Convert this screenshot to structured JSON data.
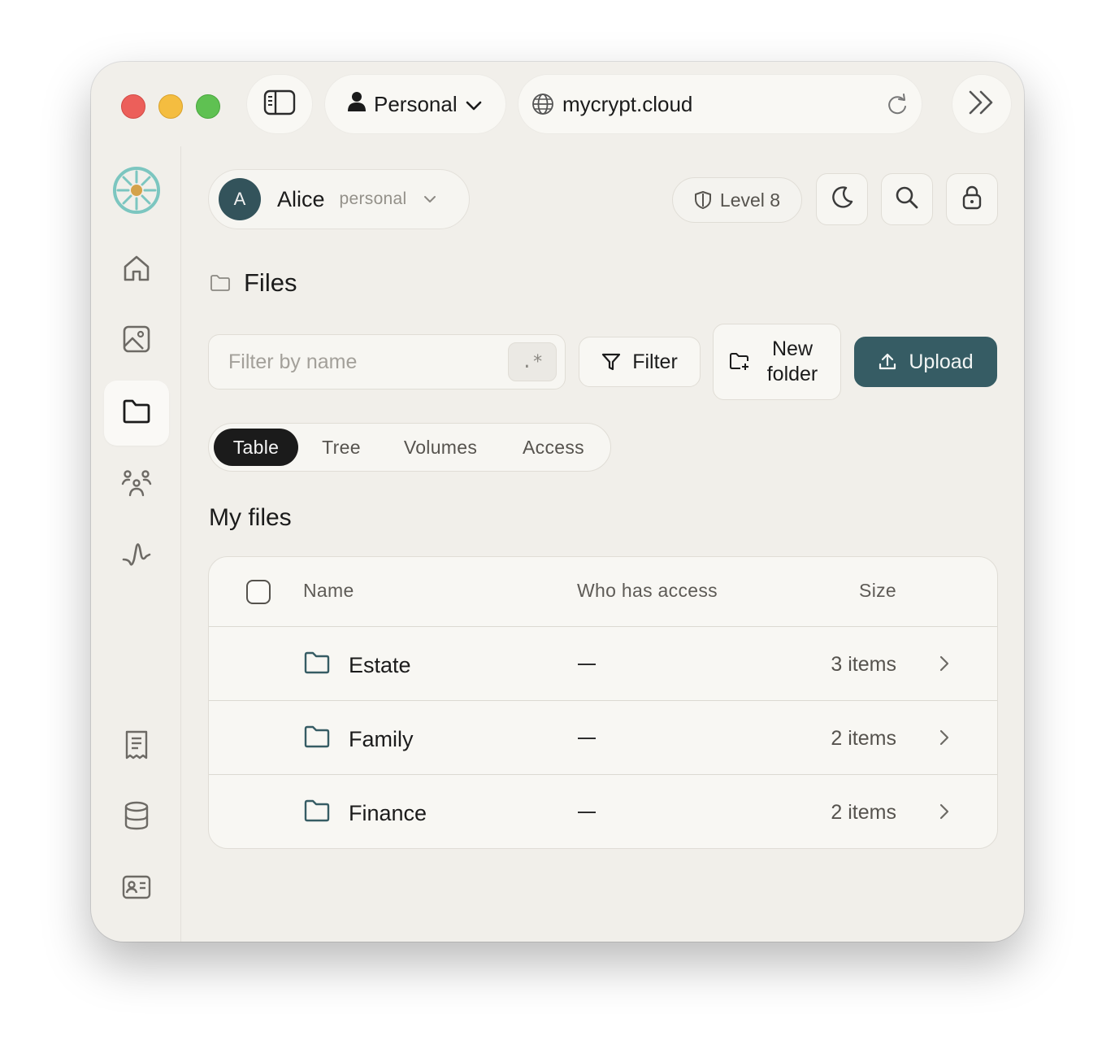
{
  "browser": {
    "profile_label": "Personal",
    "url": "mycrypt.cloud"
  },
  "header": {
    "user_initial": "A",
    "user_name": "Alice",
    "user_type": "personal",
    "level_label": "Level 8"
  },
  "page": {
    "title": "Files",
    "filter_placeholder": "Filter by name",
    "regex_label": ".*",
    "filter_button": "Filter",
    "new_folder_line1": "New",
    "new_folder_line2": "folder",
    "upload_button": "Upload"
  },
  "tabs": [
    {
      "label": "Table",
      "active": true
    },
    {
      "label": "Tree",
      "active": false
    },
    {
      "label": "Volumes",
      "active": false
    },
    {
      "label": "Access",
      "active": false
    }
  ],
  "section_title": "My files",
  "table": {
    "columns": {
      "name": "Name",
      "access": "Who has access",
      "size": "Size"
    },
    "rows": [
      {
        "name": "Estate",
        "access": "—",
        "size": "3 items"
      },
      {
        "name": "Family",
        "access": "—",
        "size": "2 items"
      },
      {
        "name": "Finance",
        "access": "—",
        "size": "2 items"
      }
    ]
  },
  "sidebar_icons": [
    "logo-icon",
    "home-icon",
    "image-icon",
    "folder-icon",
    "people-icon",
    "activity-icon",
    "receipt-icon",
    "database-icon",
    "contact-card-icon"
  ],
  "colors": {
    "accent": "#365c64",
    "avatar": "#33535b",
    "window_bg": "#f1efea",
    "logo": "#7cc6c0",
    "logo_center": "#d4a24a"
  }
}
